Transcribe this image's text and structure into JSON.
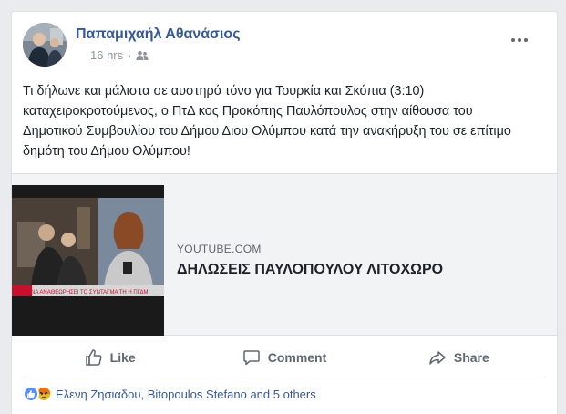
{
  "post": {
    "author": "Παπαμιχαήλ Αθανάσιος",
    "time": "16 hrs",
    "privacy_icon": "friends-icon",
    "more_icon": "more-options-icon",
    "text": "Τι δήλωνε και μάλιστα σε αυστηρό τόνο για Τουρκία και Σκόπια (3:10) καταχειροκροτούμενος, ο ΠτΔ κος Προκόπης Παυλόπουλος στην αίθουσα του Δημοτικού Συμβουλίου του Δήμου Διου Ολύμπου κατά την ανακήρυξη του σε επίτιμο δημότη του Δήμου Ολύμπου!"
  },
  "link_preview": {
    "domain": "YOUTUBE.COM",
    "title": "ΔΗΛΩΣΕΙΣ ΠΑΥΛΟΠΟΥΛΟΥ ΛΙΤΟΧΩΡΟ",
    "thumbnail_caption": "ΡΩΤΑ ΝΑ ΑΝΑΘΕΩΡΗΣΕΙ ΤΟ ΣΥΝΤΑΓΜΑ ΤΗ Η ΠΓΔΜ"
  },
  "actions": {
    "like": "Like",
    "comment": "Comment",
    "share": "Share"
  },
  "reactions": {
    "names": "Ελενη Ζησιαδου, Bitopoulos Stefano and 5 others",
    "icons": [
      "like-reaction-icon",
      "angry-reaction-icon"
    ]
  },
  "colors": {
    "author_link": "#365899",
    "like_reaction": "#5890ff",
    "angry_reaction": "#f0ba15",
    "muted_text": "#606770"
  }
}
